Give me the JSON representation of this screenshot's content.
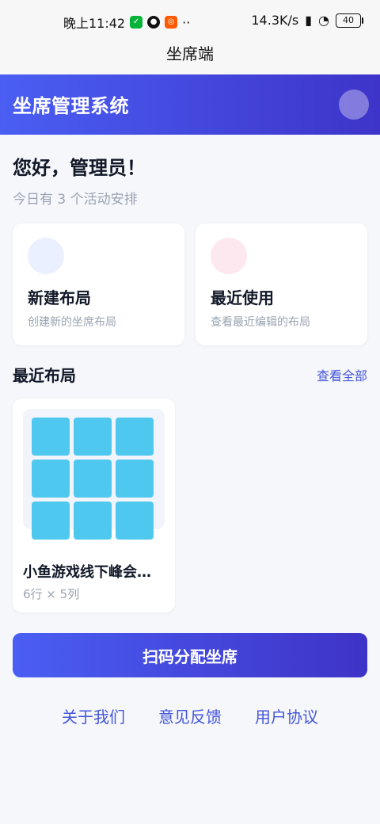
{
  "status_bar": {
    "time": "晚上11:42",
    "extra_icon_1": "wechat-icon",
    "extra_icon_2": "qq-icon",
    "extra_icon_3": "shop-icon",
    "dots": "··",
    "speed": "14.3K/s",
    "battery": "40"
  },
  "top_title": "坐席端",
  "header": {
    "title": "坐席管理系统"
  },
  "greeting": "您好，管理员！",
  "subgreeting": "今日有 3 个活动安排",
  "actions": [
    {
      "title": "新建布局",
      "desc": "创建新的坐席布局"
    },
    {
      "title": "最近使用",
      "desc": "查看最近编辑的布局"
    }
  ],
  "recent_section": {
    "title": "最近布局",
    "link": "查看全部"
  },
  "recent_layout": {
    "name": "小鱼游戏线下峰会…",
    "meta": "6行 × 5列"
  },
  "primary_button": "扫码分配坐席",
  "footer": {
    "about": "关于我们",
    "feedback": "意见反馈",
    "agreement": "用户协议"
  }
}
